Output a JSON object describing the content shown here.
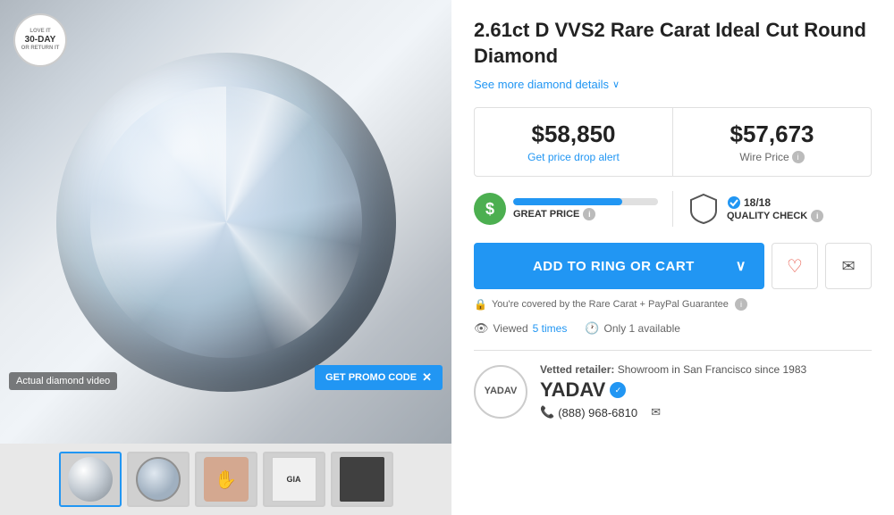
{
  "product": {
    "title": "2.61ct D VVS2 Rare Carat Ideal Cut Round Diamond",
    "see_more_label": "See more diamond details",
    "price_main": "$58,850",
    "price_main_label": "Get price drop alert",
    "price_wire": "$57,673",
    "price_wire_label": "Wire Price",
    "badge_great_price_label": "GREAT PRICE",
    "badge_quality_label": "QUALITY CHECK",
    "quality_score": "18/18",
    "add_to_cart_label": "ADD TO RING OR CART",
    "guarantee_text": "You're covered by the Rare Carat + PayPal Guarantee",
    "viewed_text": "Viewed",
    "viewed_count": "5 times",
    "available_text": "Only 1 available",
    "promo_label": "GET PROMO CODE"
  },
  "thumbnails": [
    {
      "id": "thumb-1",
      "type": "circle"
    },
    {
      "id": "thumb-2",
      "type": "pattern"
    },
    {
      "id": "thumb-3",
      "type": "hand"
    },
    {
      "id": "thumb-4",
      "type": "gia"
    },
    {
      "id": "thumb-5",
      "type": "box"
    }
  ],
  "badge_30day": {
    "love": "LOVE IT",
    "days": "30-DAY",
    "returns": "OR RETURN IT"
  },
  "actual_video_label": "Actual diamond video",
  "retailer": {
    "logo_text": "YADAV",
    "vetted_label": "Vetted retailer:",
    "vetted_desc": "Showroom in San Francisco since 1983",
    "name": "YADAV",
    "phone": "(888) 968-6810"
  }
}
